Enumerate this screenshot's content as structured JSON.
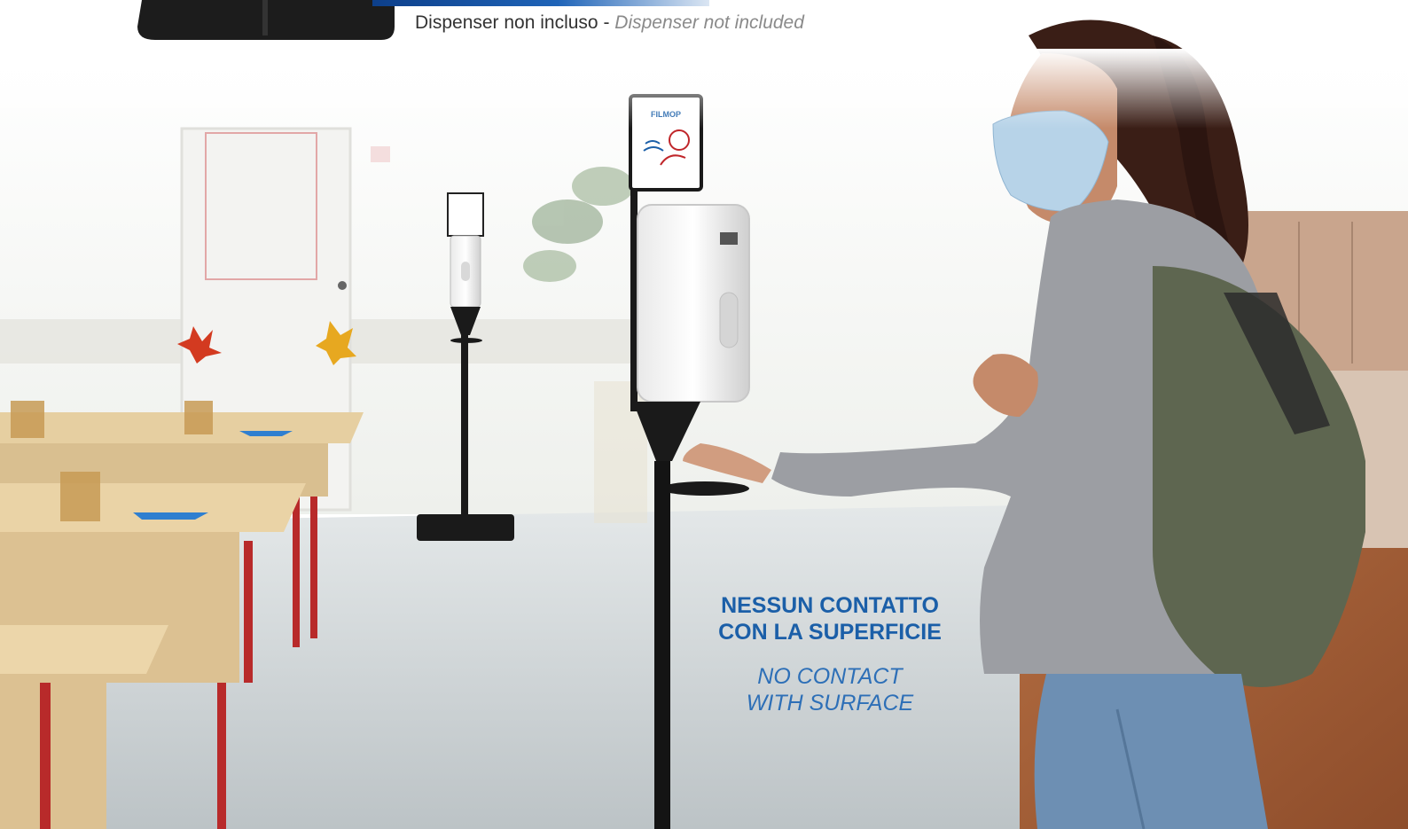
{
  "caption": {
    "it": "Dispenser non incluso - ",
    "en": "Dispenser not included"
  },
  "headline": {
    "it_line1": "NESSUN CONTATTO",
    "it_line2": "CON LA SUPERFICIE",
    "en_line1": "NO CONTACT",
    "en_line2": "WITH SURFACE"
  },
  "colors": {
    "accent_blue": "#1b5fa8",
    "stand_black": "#1a1a1a",
    "desk_wood": "#e6cfa1",
    "desk_leg_red": "#b82a2a"
  }
}
